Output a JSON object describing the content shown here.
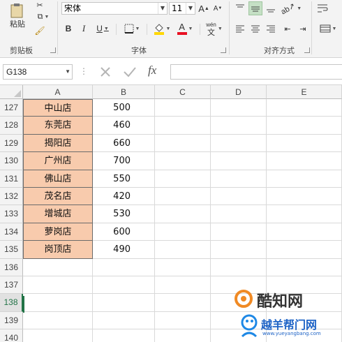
{
  "ribbon": {
    "clipboard": {
      "paste_label": "粘贴",
      "group_label": "剪贴板"
    },
    "font": {
      "font_name": "宋体",
      "font_size": "11",
      "bold": "B",
      "italic": "I",
      "underline": "U",
      "grow_font": "A",
      "shrink_font": "A",
      "font_color_glyph": "A",
      "phonetic_top": "wén",
      "phonetic_bottom": "文",
      "group_label": "字体"
    },
    "alignment": {
      "group_label": "对齐方式"
    },
    "colors": {
      "fill": "#ffd700",
      "font_color": "#e81123"
    }
  },
  "formula_bar": {
    "name_box": "G138",
    "fx": "fx",
    "formula": ""
  },
  "sheet": {
    "columns": [
      "A",
      "B",
      "C",
      "D",
      "E"
    ],
    "rows": [
      {
        "num": "127",
        "a": "中山店",
        "b": "500"
      },
      {
        "num": "128",
        "a": "东莞店",
        "b": "460"
      },
      {
        "num": "129",
        "a": "揭阳店",
        "b": "660"
      },
      {
        "num": "130",
        "a": "广州店",
        "b": "700"
      },
      {
        "num": "131",
        "a": "佛山店",
        "b": "550"
      },
      {
        "num": "132",
        "a": "茂名店",
        "b": "420"
      },
      {
        "num": "133",
        "a": "增城店",
        "b": "530"
      },
      {
        "num": "134",
        "a": "萝岗店",
        "b": "600"
      },
      {
        "num": "135",
        "a": "岗顶店",
        "b": "490"
      },
      {
        "num": "136",
        "a": "",
        "b": ""
      },
      {
        "num": "137",
        "a": "",
        "b": ""
      },
      {
        "num": "138",
        "a": "",
        "b": ""
      },
      {
        "num": "139",
        "a": "",
        "b": ""
      },
      {
        "num": "140",
        "a": "",
        "b": ""
      }
    ],
    "filled_rows": 9,
    "selected_row": "138",
    "a_fill": "#f8cbad"
  },
  "watermark": {
    "main": "酷知网",
    "sub": "越羊帮门网",
    "url": "www.yueyangbang.com"
  }
}
